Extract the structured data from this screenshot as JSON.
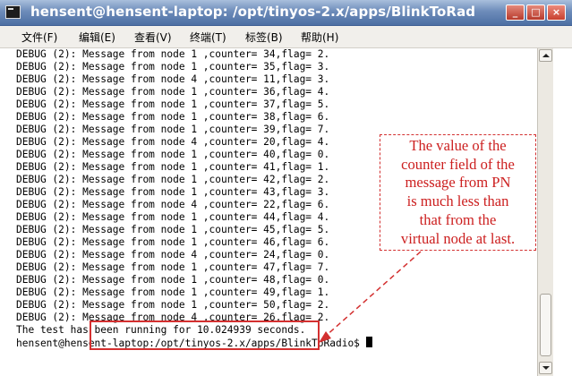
{
  "window": {
    "title": "hensent@hensent-laptop: /opt/tinyos-2.x/apps/BlinkToRad",
    "min_glyph": "_",
    "max_glyph": "□",
    "close_glyph": "×"
  },
  "menu": {
    "items": [
      "文件(F)",
      "编辑(E)",
      "查看(V)",
      "终端(T)",
      "标签(B)",
      "帮助(H)"
    ]
  },
  "terminal": {
    "lines": [
      "DEBUG (2): Message from node 1 ,counter= 34,flag= 2.",
      "DEBUG (2): Message from node 1 ,counter= 35,flag= 3.",
      "DEBUG (2): Message from node 4 ,counter= 11,flag= 3.",
      "DEBUG (2): Message from node 1 ,counter= 36,flag= 4.",
      "DEBUG (2): Message from node 1 ,counter= 37,flag= 5.",
      "DEBUG (2): Message from node 1 ,counter= 38,flag= 6.",
      "DEBUG (2): Message from node 1 ,counter= 39,flag= 7.",
      "DEBUG (2): Message from node 4 ,counter= 20,flag= 4.",
      "DEBUG (2): Message from node 1 ,counter= 40,flag= 0.",
      "DEBUG (2): Message from node 1 ,counter= 41,flag= 1.",
      "DEBUG (2): Message from node 1 ,counter= 42,flag= 2.",
      "DEBUG (2): Message from node 1 ,counter= 43,flag= 3.",
      "DEBUG (2): Message from node 4 ,counter= 22,flag= 6.",
      "DEBUG (2): Message from node 1 ,counter= 44,flag= 4.",
      "DEBUG (2): Message from node 1 ,counter= 45,flag= 5.",
      "DEBUG (2): Message from node 1 ,counter= 46,flag= 6.",
      "DEBUG (2): Message from node 4 ,counter= 24,flag= 0.",
      "DEBUG (2): Message from node 1 ,counter= 47,flag= 7.",
      "DEBUG (2): Message from node 1 ,counter= 48,flag= 0.",
      "DEBUG (2): Message from node 1 ,counter= 49,flag= 1.",
      "DEBUG (2): Message from node 1 ,counter= 50,flag= 2.",
      "DEBUG (2): Message from node 4 ,counter= 26,flag= 2.",
      "The test has been running for 10.024939 seconds."
    ],
    "prompt": "hensent@hensent-laptop:/opt/tinyos-2.x/apps/BlinkToRadio$ "
  },
  "annotation": {
    "lines": [
      "The value of the",
      "counter field of the",
      "message from PN",
      "is much less than",
      "that from the",
      "virtual node at last."
    ],
    "color": "#cc1f1f"
  },
  "icons": {
    "app": "terminal-icon",
    "scroll_up": "scroll-up-arrow-icon",
    "scroll_down": "scroll-down-arrow-icon"
  }
}
